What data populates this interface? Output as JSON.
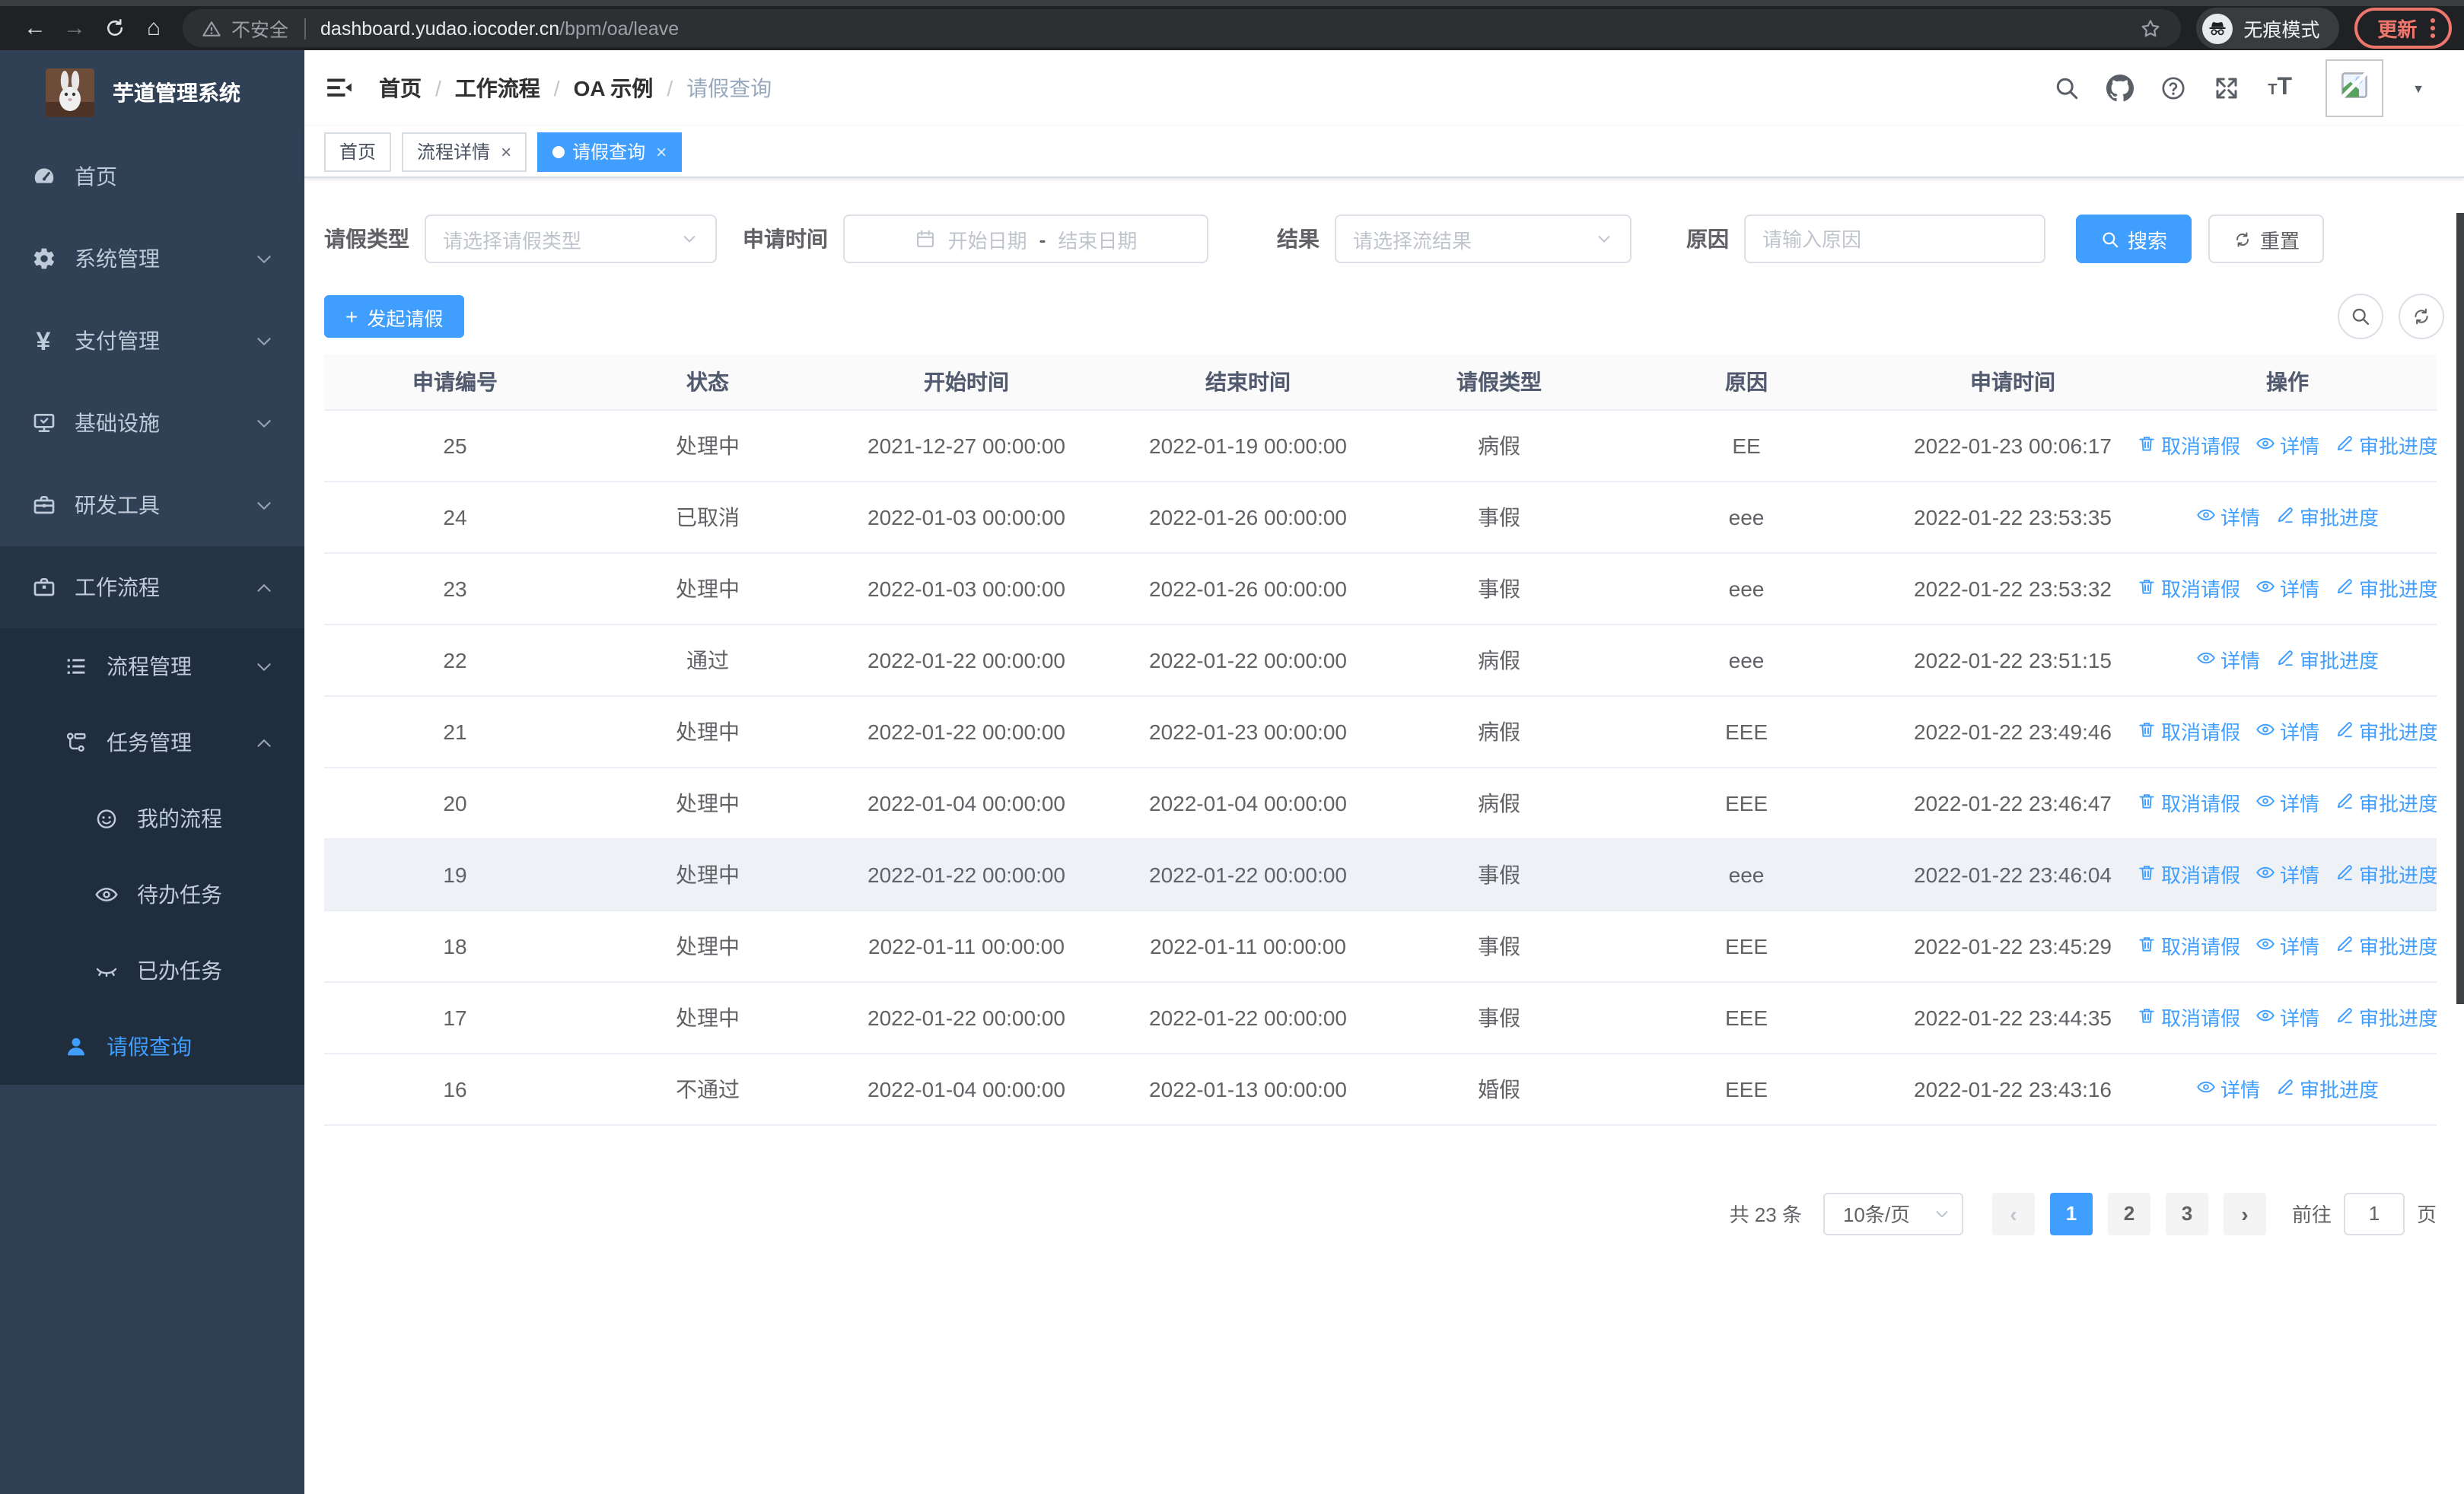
{
  "browser": {
    "security_label": "不安全",
    "url_host": "dashboard.yudao.iocoder.cn",
    "url_path": "/bpm/oa/leave",
    "incognito_label": "无痕模式",
    "update_label": "更新",
    "nav_icons": [
      "back-icon",
      "forward-icon",
      "reload-icon",
      "home-icon",
      "bookmark-star-icon",
      "menu-dots-icon"
    ]
  },
  "sidebar": {
    "logo_title": "芋道管理系统",
    "menu": [
      {
        "label": "首页",
        "icon": "dashboard-icon",
        "level": 1,
        "chevron": null,
        "active": false,
        "block": false
      },
      {
        "label": "系统管理",
        "icon": "gear-icon",
        "level": 1,
        "chevron": "down",
        "active": false,
        "block": false
      },
      {
        "label": "支付管理",
        "icon": "yen-icon",
        "level": 1,
        "chevron": "down",
        "active": false,
        "block": false
      },
      {
        "label": "基础设施",
        "icon": "monitor-icon",
        "level": 1,
        "chevron": "down",
        "active": false,
        "block": false
      },
      {
        "label": "研发工具",
        "icon": "toolbox-icon",
        "level": 1,
        "chevron": "down",
        "active": false,
        "block": false
      },
      {
        "label": "工作流程",
        "icon": "briefcase-icon",
        "level": 1,
        "chevron": "up",
        "active": false,
        "block": false,
        "parent_open": true
      },
      {
        "label": "流程管理",
        "icon": "list-tree-icon",
        "level": 2,
        "chevron": "down",
        "active": false,
        "block": true
      },
      {
        "label": "任务管理",
        "icon": "flow-icon",
        "level": 2,
        "chevron": "up",
        "active": false,
        "block": true
      },
      {
        "label": "我的流程",
        "icon": "robot-icon",
        "level": 3,
        "chevron": null,
        "active": false,
        "block": true
      },
      {
        "label": "待办任务",
        "icon": "eye-open-icon",
        "level": 3,
        "chevron": null,
        "active": false,
        "block": true
      },
      {
        "label": "已办任务",
        "icon": "eye-closed-icon",
        "level": 3,
        "chevron": null,
        "active": false,
        "block": true
      },
      {
        "label": "请假查询",
        "icon": "user-icon",
        "level": 2,
        "chevron": null,
        "active": true,
        "block": true
      }
    ]
  },
  "navbar": {
    "breadcrumb": [
      {
        "label": "首页",
        "current": false
      },
      {
        "label": "工作流程",
        "current": false
      },
      {
        "label": "OA 示例",
        "current": false
      },
      {
        "label": "请假查询",
        "current": true
      }
    ],
    "right_icons": [
      "search-icon",
      "github-icon",
      "help-icon",
      "fullscreen-icon",
      "font-size-icon"
    ]
  },
  "tags": {
    "items": [
      {
        "label": "首页",
        "active": false,
        "closable": false
      },
      {
        "label": "流程详情",
        "active": false,
        "closable": true
      },
      {
        "label": "请假查询",
        "active": true,
        "closable": true
      }
    ]
  },
  "filters": {
    "leave_type": {
      "label": "请假类型",
      "placeholder": "请选择请假类型"
    },
    "apply_time": {
      "label": "申请时间",
      "start_placeholder": "开始日期",
      "separator": "-",
      "end_placeholder": "结束日期"
    },
    "result": {
      "label": "结果",
      "placeholder": "请选择流结果"
    },
    "reason": {
      "label": "原因",
      "placeholder": "请输入原因"
    },
    "search_label": "搜索",
    "reset_label": "重置"
  },
  "toolbar": {
    "create_label": "发起请假"
  },
  "table": {
    "columns": [
      "申请编号",
      "状态",
      "开始时间",
      "结束时间",
      "请假类型",
      "原因",
      "申请时间",
      "操作"
    ],
    "action_labels": {
      "cancel": "取消请假",
      "detail": "详情",
      "progress": "审批进度"
    },
    "rows": [
      {
        "id": "25",
        "status": "处理中",
        "start": "2021-12-27 00:00:00",
        "end": "2022-01-19 00:00:00",
        "type": "病假",
        "reason": "EE",
        "applied": "2022-01-23 00:06:17",
        "actions": [
          "cancel",
          "detail",
          "progress"
        ],
        "hover": false
      },
      {
        "id": "24",
        "status": "已取消",
        "start": "2022-01-03 00:00:00",
        "end": "2022-01-26 00:00:00",
        "type": "事假",
        "reason": "eee",
        "applied": "2022-01-22 23:53:35",
        "actions": [
          "detail",
          "progress"
        ],
        "hover": false
      },
      {
        "id": "23",
        "status": "处理中",
        "start": "2022-01-03 00:00:00",
        "end": "2022-01-26 00:00:00",
        "type": "事假",
        "reason": "eee",
        "applied": "2022-01-22 23:53:32",
        "actions": [
          "cancel",
          "detail",
          "progress"
        ],
        "hover": false
      },
      {
        "id": "22",
        "status": "通过",
        "start": "2022-01-22 00:00:00",
        "end": "2022-01-22 00:00:00",
        "type": "病假",
        "reason": "eee",
        "applied": "2022-01-22 23:51:15",
        "actions": [
          "detail",
          "progress"
        ],
        "hover": false
      },
      {
        "id": "21",
        "status": "处理中",
        "start": "2022-01-22 00:00:00",
        "end": "2022-01-23 00:00:00",
        "type": "病假",
        "reason": "EEE",
        "applied": "2022-01-22 23:49:46",
        "actions": [
          "cancel",
          "detail",
          "progress"
        ],
        "hover": false
      },
      {
        "id": "20",
        "status": "处理中",
        "start": "2022-01-04 00:00:00",
        "end": "2022-01-04 00:00:00",
        "type": "病假",
        "reason": "EEE",
        "applied": "2022-01-22 23:46:47",
        "actions": [
          "cancel",
          "detail",
          "progress"
        ],
        "hover": false
      },
      {
        "id": "19",
        "status": "处理中",
        "start": "2022-01-22 00:00:00",
        "end": "2022-01-22 00:00:00",
        "type": "事假",
        "reason": "eee",
        "applied": "2022-01-22 23:46:04",
        "actions": [
          "cancel",
          "detail",
          "progress"
        ],
        "hover": true
      },
      {
        "id": "18",
        "status": "处理中",
        "start": "2022-01-11 00:00:00",
        "end": "2022-01-11 00:00:00",
        "type": "事假",
        "reason": "EEE",
        "applied": "2022-01-22 23:45:29",
        "actions": [
          "cancel",
          "detail",
          "progress"
        ],
        "hover": false
      },
      {
        "id": "17",
        "status": "处理中",
        "start": "2022-01-22 00:00:00",
        "end": "2022-01-22 00:00:00",
        "type": "事假",
        "reason": "EEE",
        "applied": "2022-01-22 23:44:35",
        "actions": [
          "cancel",
          "detail",
          "progress"
        ],
        "hover": false
      },
      {
        "id": "16",
        "status": "不通过",
        "start": "2022-01-04 00:00:00",
        "end": "2022-01-13 00:00:00",
        "type": "婚假",
        "reason": "EEE",
        "applied": "2022-01-22 23:43:16",
        "actions": [
          "detail",
          "progress"
        ],
        "hover": false
      }
    ]
  },
  "pagination": {
    "total_label": "共 23 条",
    "page_size_label": "10条/页",
    "pages": [
      "1",
      "2",
      "3"
    ],
    "active_page": "1",
    "goto_label": "前往",
    "goto_value": "1",
    "page_unit_label": "页"
  },
  "colors": {
    "primary": "#409eff",
    "sidebar_bg": "#304156",
    "sidebar_submenu_bg": "#1f2d3d",
    "sidebar_parent_bg": "#263445",
    "sidebar_text": "#bfcbd9",
    "chrome_bg": "#202124",
    "update_accent": "#ed766d",
    "table_border": "#ebeef5",
    "table_header_bg": "#fafafa",
    "hover_row_bg": "#eef1f6"
  }
}
